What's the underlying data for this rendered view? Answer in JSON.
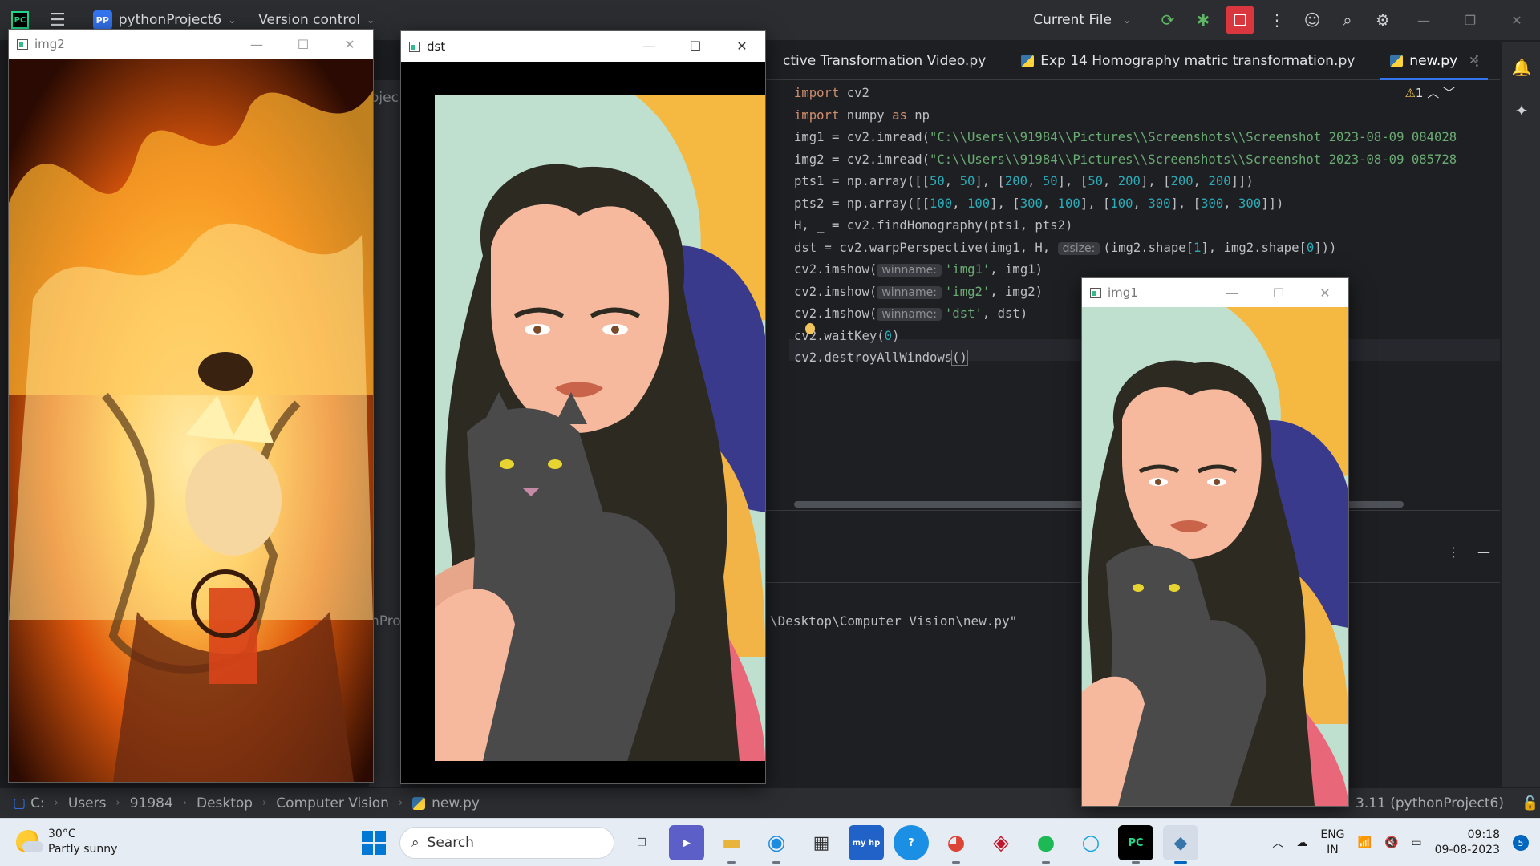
{
  "ide": {
    "project_badge": "PP",
    "project_name": "pythonProject6",
    "vcs_label": "Version control",
    "run_config": "Current File",
    "logo": "PC",
    "tabs": [
      {
        "label": "ctive Transformation Video.py",
        "active": false
      },
      {
        "label": "Exp 14 Homography matric transformation.py",
        "active": false
      },
      {
        "label": "new.py",
        "active": true
      }
    ],
    "warning_count": "1",
    "code_lines": [
      [
        {
          "t": "import",
          "c": "kw"
        },
        {
          "t": " cv2"
        }
      ],
      [
        {
          "t": "import",
          "c": "kw"
        },
        {
          "t": " numpy "
        },
        {
          "t": "as",
          "c": "kw"
        },
        {
          "t": " np"
        }
      ],
      [
        {
          "t": "img1 = cv2.imread("
        },
        {
          "t": "\"C:\\\\Users\\\\91984\\\\Pictures\\\\Screenshots\\\\Screenshot 2023-08-09 084028",
          "c": "str"
        }
      ],
      [
        {
          "t": "img2 = cv2.imread("
        },
        {
          "t": "\"C:\\\\Users\\\\91984\\\\Pictures\\\\Screenshots\\\\Screenshot 2023-08-09 085728",
          "c": "str"
        }
      ],
      [
        {
          "t": "pts1 = np.array([["
        },
        {
          "t": "50",
          "c": "num"
        },
        {
          "t": ", "
        },
        {
          "t": "50",
          "c": "num"
        },
        {
          "t": "], ["
        },
        {
          "t": "200",
          "c": "num"
        },
        {
          "t": ", "
        },
        {
          "t": "50",
          "c": "num"
        },
        {
          "t": "], ["
        },
        {
          "t": "50",
          "c": "num"
        },
        {
          "t": ", "
        },
        {
          "t": "200",
          "c": "num"
        },
        {
          "t": "], ["
        },
        {
          "t": "200",
          "c": "num"
        },
        {
          "t": ", "
        },
        {
          "t": "200",
          "c": "num"
        },
        {
          "t": "]])"
        }
      ],
      [
        {
          "t": "pts2 = np.array([["
        },
        {
          "t": "100",
          "c": "num"
        },
        {
          "t": ", "
        },
        {
          "t": "100",
          "c": "num"
        },
        {
          "t": "], ["
        },
        {
          "t": "300",
          "c": "num"
        },
        {
          "t": ", "
        },
        {
          "t": "100",
          "c": "num"
        },
        {
          "t": "], ["
        },
        {
          "t": "100",
          "c": "num"
        },
        {
          "t": ", "
        },
        {
          "t": "300",
          "c": "num"
        },
        {
          "t": "], ["
        },
        {
          "t": "300",
          "c": "num"
        },
        {
          "t": ", "
        },
        {
          "t": "300",
          "c": "num"
        },
        {
          "t": "]])"
        }
      ],
      [
        {
          "t": "H, _ = cv2.findHomography(pts1, pts2)"
        }
      ],
      [
        {
          "t": "dst = cv2.warpPerspective(img1, H, "
        },
        {
          "t": "dsize:",
          "c": "hint"
        },
        {
          "t": "(img2.shape["
        },
        {
          "t": "1",
          "c": "num"
        },
        {
          "t": "], img2.shape["
        },
        {
          "t": "0",
          "c": "num"
        },
        {
          "t": "]))"
        }
      ],
      [
        {
          "t": "cv2.imshow("
        },
        {
          "t": "winname:",
          "c": "hint"
        },
        {
          "t": "'img1'",
          "c": "str"
        },
        {
          "t": ", img1)"
        }
      ],
      [
        {
          "t": "cv2.imshow("
        },
        {
          "t": "winname:",
          "c": "hint"
        },
        {
          "t": "'img2'",
          "c": "str"
        },
        {
          "t": ", img2)"
        }
      ],
      [
        {
          "t": "cv2.imshow("
        },
        {
          "t": "winname:",
          "c": "hint"
        },
        {
          "t": "'dst'",
          "c": "str"
        },
        {
          "t": ", dst)"
        }
      ],
      [
        {
          "t": "cv2.waitKey("
        },
        {
          "t": "0",
          "c": "num"
        },
        {
          "t": ")"
        }
      ],
      [
        {
          "t": "cv2.destroyAllWindows"
        },
        {
          "t": "()",
          "c": "paren"
        }
      ]
    ],
    "project_panel_fragments": [
      "ojec",
      "nPro"
    ],
    "run_output": "\\Desktop\\Computer Vision\\new.py\"",
    "breadcrumbs": [
      "C:",
      "Users",
      "91984",
      "Desktop",
      "Computer Vision",
      "new.py"
    ],
    "interpreter": "3.11 (pythonProject6)"
  },
  "windows": {
    "img2": {
      "title": "img2"
    },
    "dst": {
      "title": "dst"
    },
    "img1": {
      "title": "img1"
    }
  },
  "taskbar": {
    "temperature": "30°C",
    "weather": "Partly sunny",
    "search_label": "Search",
    "lang_top": "ENG",
    "lang_bottom": "IN",
    "time": "09:18",
    "date": "09-08-2023",
    "notifications": "5"
  },
  "colors": {
    "ide_bg": "#1e1f22",
    "ide_panel": "#2b2d30",
    "accent": "#3574f0",
    "stop": "#d9363e",
    "keyword": "#cf8e6d",
    "string": "#6aab73",
    "number": "#2aacb8"
  }
}
